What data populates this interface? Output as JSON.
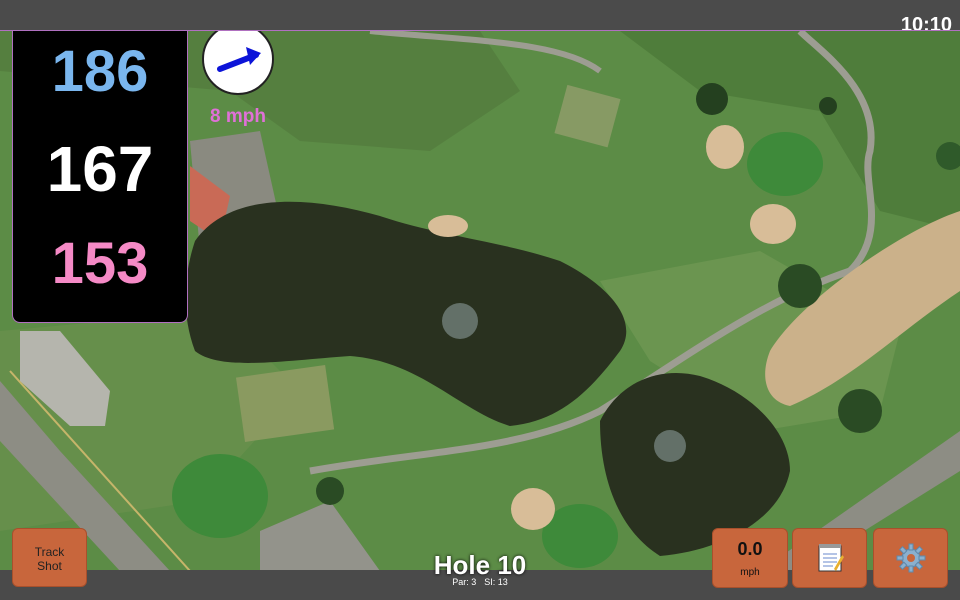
{
  "status": {
    "time": "10:10"
  },
  "distances": {
    "back": "186",
    "middle": "167",
    "front": "153"
  },
  "wind": {
    "speed": "8 mph",
    "icon": "wind-arrow-icon"
  },
  "hole": {
    "title": "Hole 10",
    "par": "Par: 3",
    "stroke_index": "SI: 13"
  },
  "buttons": {
    "track_shot_line1": "Track",
    "track_shot_line2": "Shot",
    "speed_value": "0.0",
    "speed_unit": "mph",
    "notes_icon": "notepad-icon",
    "settings_icon": "gear-icon"
  },
  "colors": {
    "button": "#c8663c",
    "back": "#7ab6ee",
    "middle": "#ffffff",
    "front": "#f58ac6",
    "wind_text": "#e070d8"
  }
}
